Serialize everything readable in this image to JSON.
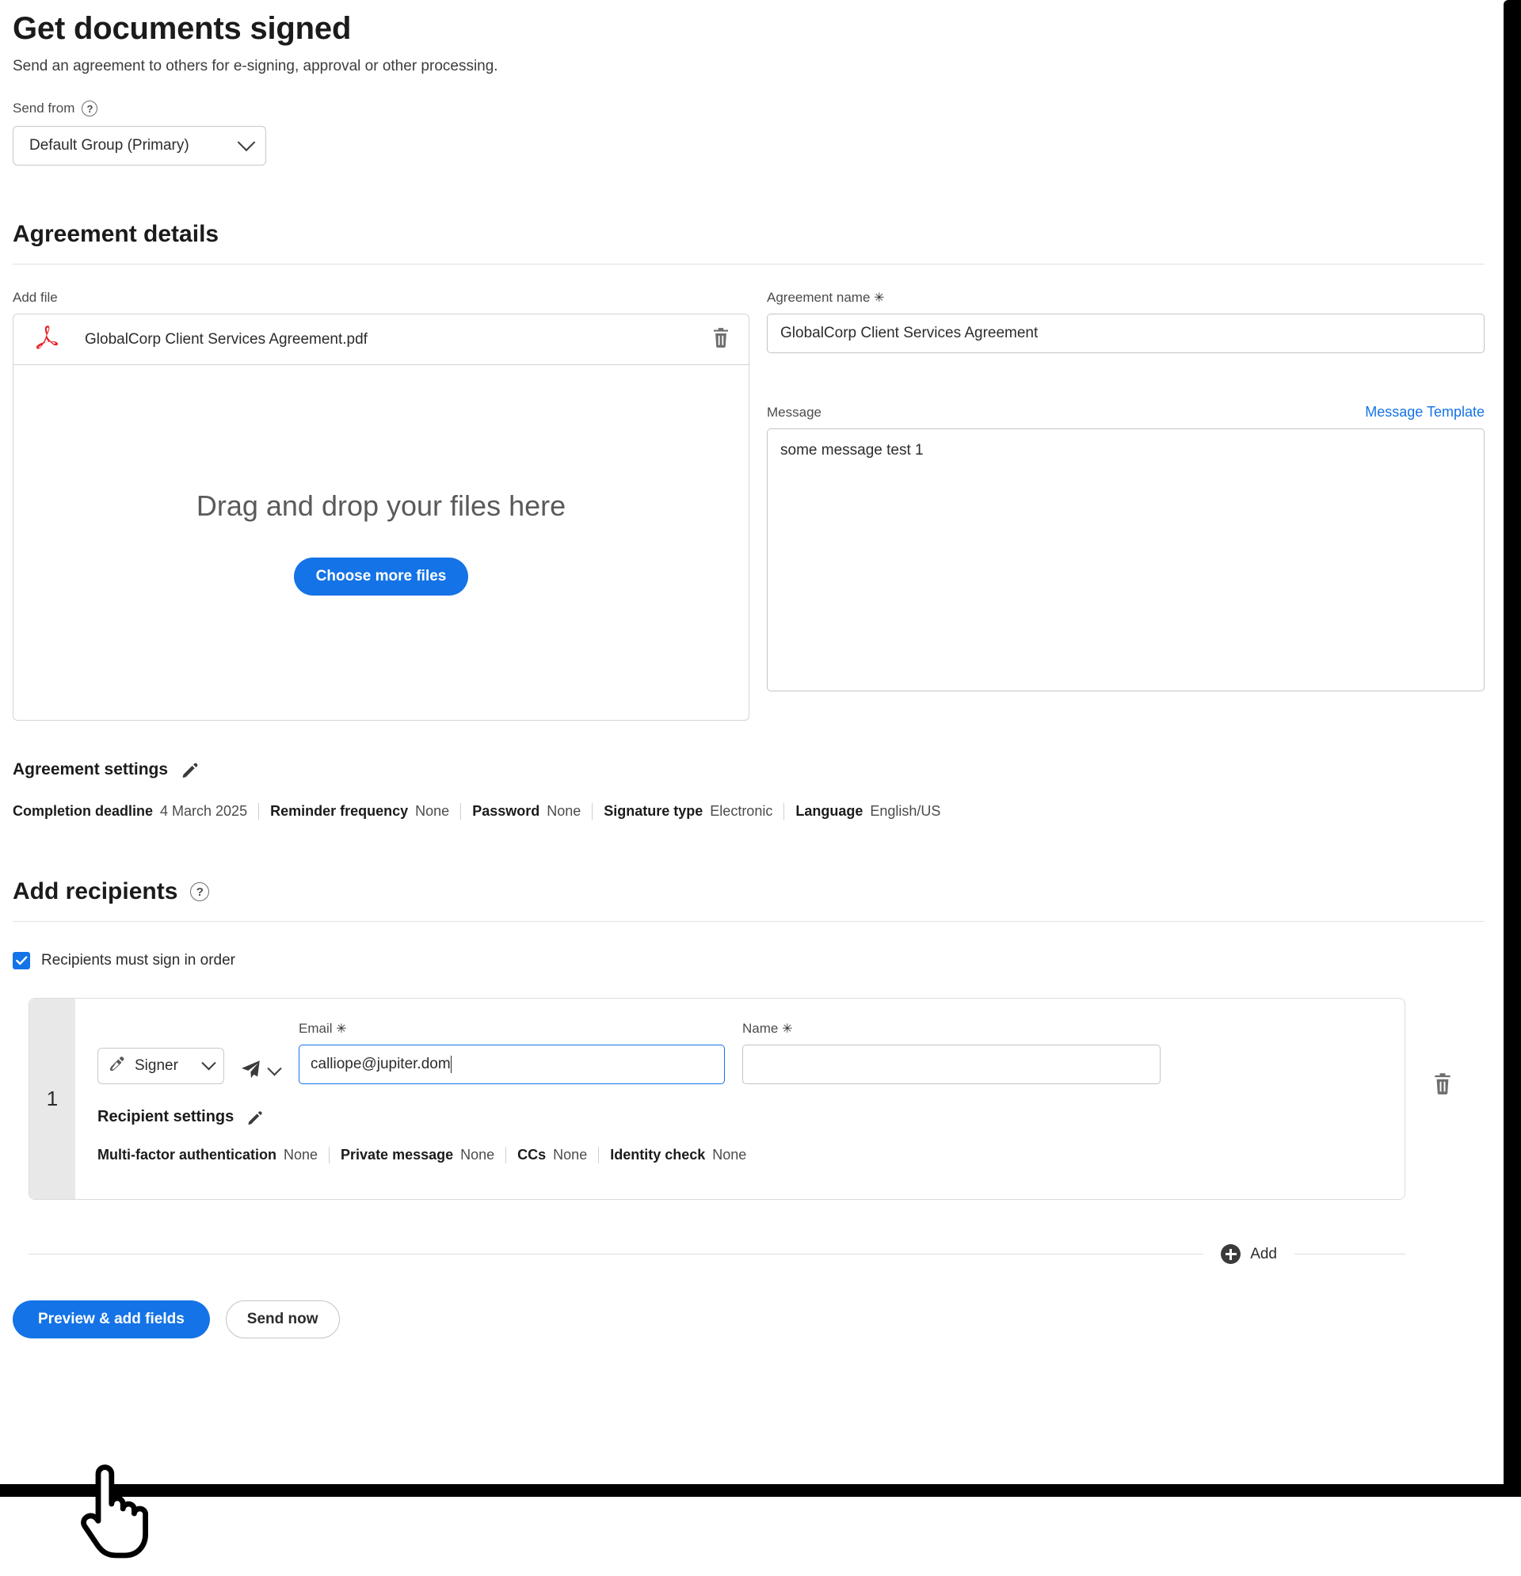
{
  "header": {
    "title": "Get documents signed",
    "subtitle": "Send an agreement to others for e-signing, approval or other processing.",
    "send_from_label": "Send from",
    "send_from_value": "Default Group (Primary)",
    "help_icon": "question-mark-circle-icon"
  },
  "agreement_details": {
    "section_title": "Agreement details",
    "add_file_label": "Add file",
    "file": {
      "name": "GlobalCorp Client Services Agreement.pdf",
      "icon": "pdf-acrobat-icon",
      "delete_icon": "trash-icon"
    },
    "dropzone": {
      "text": "Drag and drop your files here",
      "button_label": "Choose more files"
    },
    "agreement_name_label": "Agreement name",
    "agreement_name_required": "✳",
    "agreement_name_value": "GlobalCorp Client Services Agreement",
    "message_label": "Message",
    "message_template_link": "Message Template",
    "message_value": "some message test 1",
    "message_placeholder": ""
  },
  "agreement_settings": {
    "title": "Agreement settings",
    "edit_icon": "pencil-icon",
    "items": [
      {
        "key": "Completion deadline",
        "value": "4 March 2025"
      },
      {
        "key": "Reminder frequency",
        "value": "None"
      },
      {
        "key": "Password",
        "value": "None"
      },
      {
        "key": "Signature type",
        "value": "Electronic"
      },
      {
        "key": "Language",
        "value": "English/US"
      }
    ]
  },
  "add_recipients": {
    "section_title": "Add recipients",
    "help_icon": "question-mark-circle-icon",
    "sign_in_order_label": "Recipients must sign in order",
    "sign_in_order_checked": true,
    "recipient": {
      "number": "1",
      "role_label": "Signer",
      "role_icon": "pen-signature-icon",
      "delivery_icon": "paper-plane-icon",
      "email_label": "Email",
      "email_required": "✳",
      "email_value": "calliope@jupiter.dom",
      "name_label": "Name",
      "name_required": "✳",
      "name_value": "",
      "delete_icon": "trash-icon",
      "settings_title": "Recipient settings",
      "settings_edit_icon": "pencil-icon",
      "settings": [
        {
          "key": "Multi-factor authentication",
          "value": "None"
        },
        {
          "key": "Private message",
          "value": "None"
        },
        {
          "key": "CCs",
          "value": "None"
        },
        {
          "key": "Identity check",
          "value": "None"
        }
      ]
    },
    "add_label": "Add",
    "add_icon": "plus-circle-icon"
  },
  "footer": {
    "primary_button": "Preview & add fields",
    "secondary_button": "Send now"
  },
  "colors": {
    "accent": "#1473e6",
    "pdf_red": "#e8252a",
    "text": "#2c2c2c",
    "border": "#c4c4c4"
  }
}
